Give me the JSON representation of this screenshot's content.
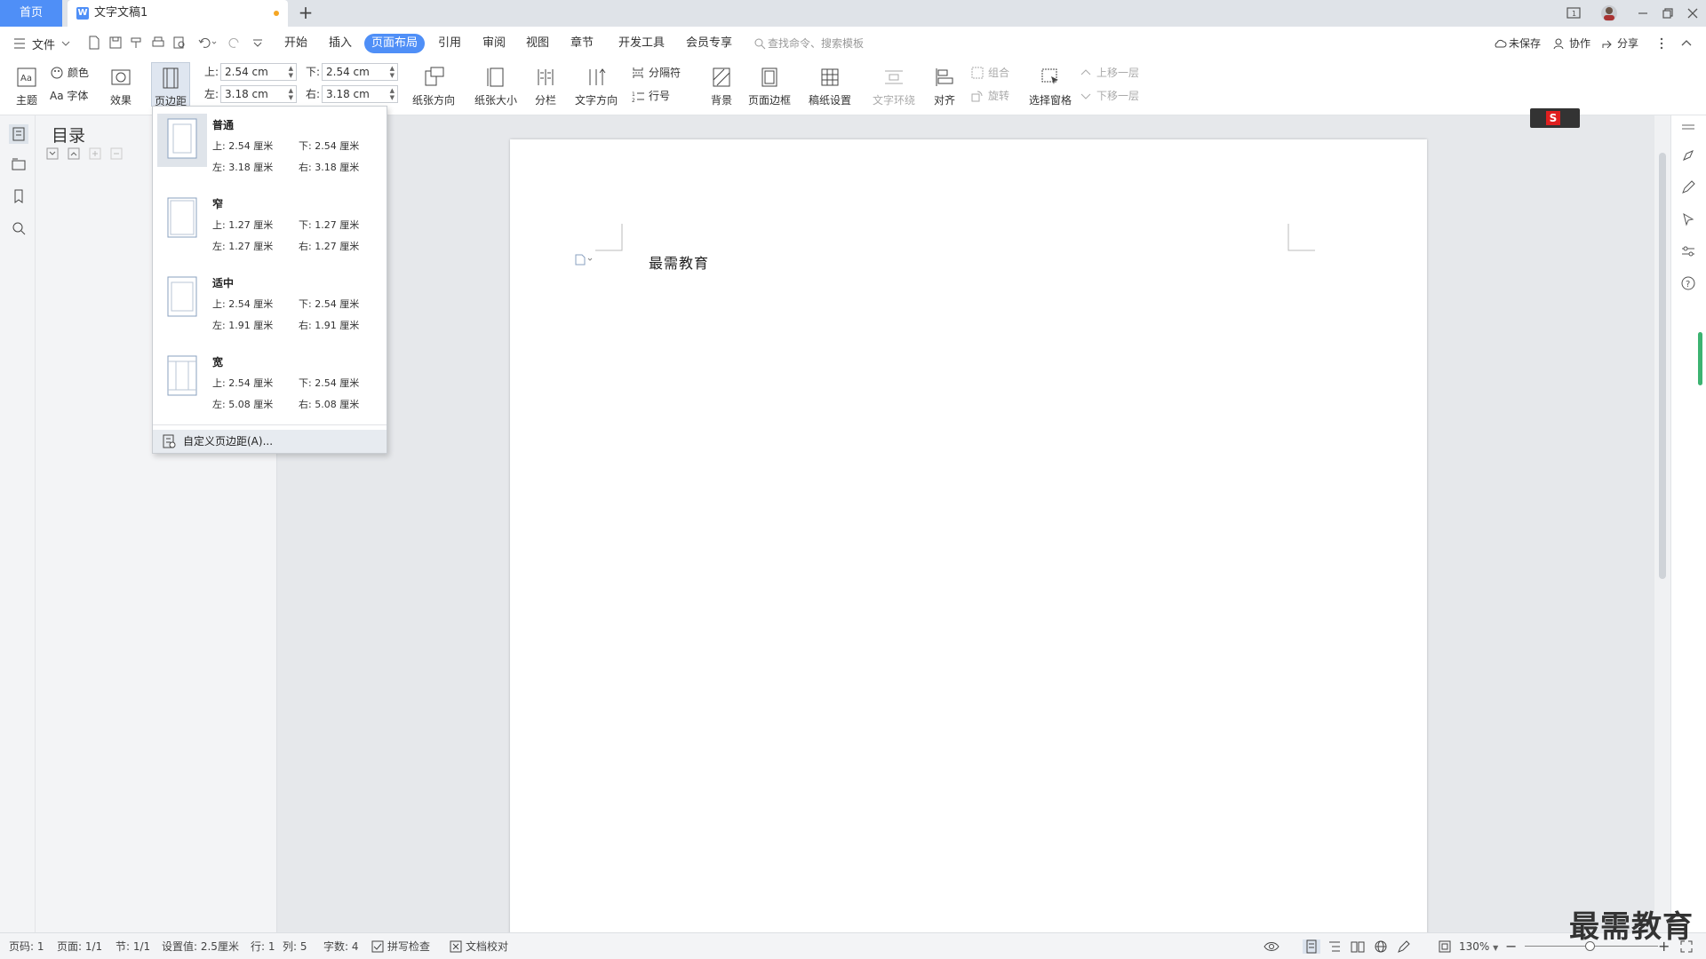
{
  "tabs": {
    "home": "首页",
    "doc": "文字文稿1",
    "new": "+"
  },
  "menubar": {
    "file": "文件",
    "items": [
      "开始",
      "插入",
      "页面布局",
      "引用",
      "审阅",
      "视图",
      "章节",
      "开发工具",
      "会员专享"
    ],
    "active_index": 2,
    "search_placeholder": "查找命令、搜索模板",
    "unsaved": "未保存",
    "collab": "协作",
    "share": "分享"
  },
  "ribbon": {
    "theme": "主题",
    "color": "颜色",
    "font": "Aa 字体",
    "effect": "效果",
    "margins": "页边距",
    "top_label": "上:",
    "top_val": "2.54 cm",
    "left_label": "左:",
    "left_val": "3.18 cm",
    "bottom_label": "下:",
    "bottom_val": "2.54 cm",
    "right_label": "右:",
    "right_val": "3.18 cm",
    "orientation": "纸张方向",
    "size": "纸张大小",
    "columns": "分栏",
    "text_dir": "文字方向",
    "breaks": "分隔符",
    "line_num": "行号",
    "background": "背景",
    "page_border": "页面边框",
    "manuscript": "稿纸设置",
    "wrap": "文字环绕",
    "align": "对齐",
    "group": "组合",
    "rotate": "旋转",
    "select_pane": "选择窗格",
    "bring_fwd": "上移一层",
    "send_back": "下移一层"
  },
  "nav": {
    "title": "目录"
  },
  "margin_menu": {
    "presets": [
      {
        "name": "普通",
        "top": "上: 2.54 厘米",
        "bottom": "下: 2.54 厘米",
        "left": "左: 3.18 厘米",
        "right": "右: 3.18 厘米"
      },
      {
        "name": "窄",
        "top": "上: 1.27 厘米",
        "bottom": "下: 1.27 厘米",
        "left": "左: 1.27 厘米",
        "right": "右: 1.27 厘米"
      },
      {
        "name": "适中",
        "top": "上: 2.54 厘米",
        "bottom": "下: 2.54 厘米",
        "left": "左: 1.91 厘米",
        "right": "右: 1.91 厘米"
      },
      {
        "name": "宽",
        "top": "上: 2.54 厘米",
        "bottom": "下: 2.54 厘米",
        "left": "左: 5.08 厘米",
        "right": "右: 5.08 厘米"
      }
    ],
    "custom": "自定义页边距(A)..."
  },
  "document": {
    "text": "最需教育"
  },
  "status": {
    "page_code": "页码: 1",
    "page": "页面: 1/1",
    "section": "节: 1/1",
    "setting": "设置值: 2.5厘米",
    "row": "行: 1",
    "col": "列: 5",
    "words": "字数: 4",
    "spell": "拼写检查",
    "proof": "文档校对",
    "zoom": "130%"
  },
  "watermark": "最需教育",
  "colors": {
    "accent": "#4f8ff7",
    "ime_red": "#e02020",
    "scroll_green": "#3cb371"
  }
}
